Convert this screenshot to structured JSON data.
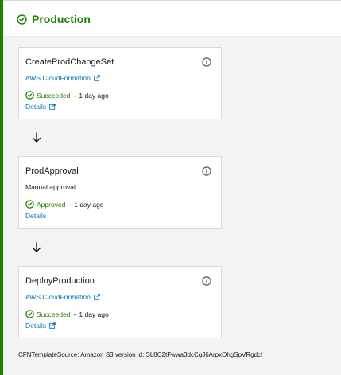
{
  "stage": {
    "title": "Production",
    "status_color": "#1d8102",
    "status_icon": "check-circle-icon"
  },
  "actions": [
    {
      "name": "CreateProdChangeSet",
      "provider": "AWS CloudFormation",
      "status": "Succeeded",
      "separator": "-",
      "time": "1 day ago",
      "details_label": "Details"
    },
    {
      "name": "ProdApproval",
      "provider": "Manual approval",
      "status": "Approved",
      "separator": "-",
      "time": "1 day ago",
      "details_label": "Details"
    },
    {
      "name": "DeployProduction",
      "provider": "AWS CloudFormation",
      "status": "Succeeded",
      "separator": "-",
      "time": "1 day ago",
      "details_label": "Details"
    }
  ],
  "footer": {
    "source_text": "CFNTemplateSource: Amazon S3 version id: SL8C2tFwwa3dcCgJ6ArpxOhgSpVRgdcf"
  },
  "colors": {
    "link": "#0073bb",
    "success": "#1d8102",
    "text": "#16191f"
  }
}
